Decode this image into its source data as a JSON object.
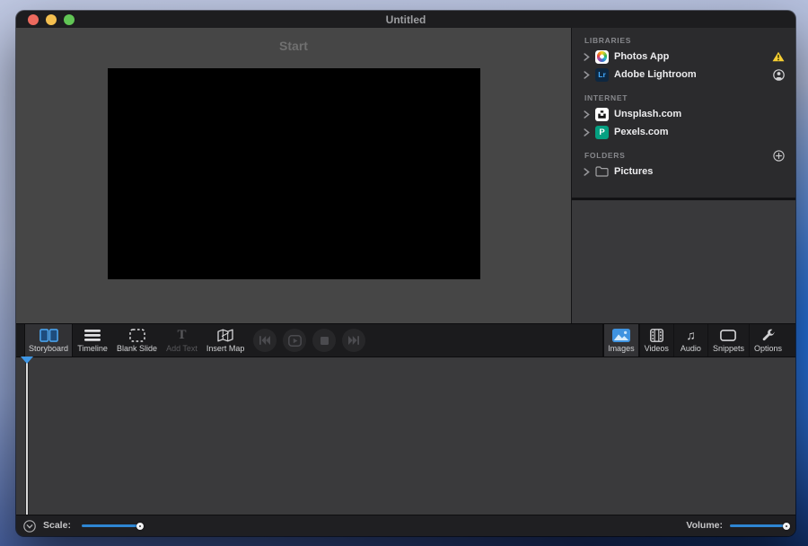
{
  "window": {
    "title": "Untitled"
  },
  "preview": {
    "start_label": "Start"
  },
  "sidebar": {
    "sections": [
      {
        "label": "LIBRARIES",
        "items": [
          {
            "label": "Photos App",
            "trailing_icon": "warning-icon"
          },
          {
            "label": "Adobe Lightroom",
            "trailing_icon": "account-icon"
          }
        ]
      },
      {
        "label": "INTERNET",
        "items": [
          {
            "label": "Unsplash.com"
          },
          {
            "label": "Pexels.com"
          }
        ]
      },
      {
        "label": "FOLDERS",
        "trailing_icon": "add-icon",
        "items": [
          {
            "label": "Pictures"
          }
        ]
      }
    ]
  },
  "icons": {
    "lightroom_glyph": "Lr",
    "pexels_glyph": "P",
    "add_text_glyph": "T",
    "audio_glyph": "♫"
  },
  "toolbar": {
    "left": [
      {
        "label": "Storyboard",
        "selected": true
      },
      {
        "label": "Timeline",
        "selected": false
      },
      {
        "label": "Blank Slide",
        "selected": false
      },
      {
        "label": "Add Text",
        "selected": false,
        "disabled": true
      },
      {
        "label": "Insert Map",
        "selected": false
      }
    ],
    "playback": [
      "skip-to-start",
      "play",
      "stop",
      "skip-to-end"
    ],
    "right": [
      {
        "label": "Images",
        "selected": true
      },
      {
        "label": "Videos",
        "selected": false
      },
      {
        "label": "Audio",
        "selected": false
      },
      {
        "label": "Snippets",
        "selected": false
      },
      {
        "label": "Options",
        "selected": false
      }
    ]
  },
  "bottom_bar": {
    "scale_label": "Scale:",
    "scale_slider_position": 1.0,
    "volume_label": "Volume:",
    "volume_slider_position": 1.0
  },
  "colors": {
    "accent_blue": "#3f93e0",
    "slider_blue": "#2e86d3",
    "warning_yellow": "#f6ce33",
    "pexels_green": "#05a081",
    "lightroom_navy": "#0e2740",
    "traffic_red": "#ed6a5e",
    "traffic_yellow": "#f4bf4f",
    "traffic_green": "#61c555",
    "storyboard_bg": "#3a3a3c",
    "preview_bg": "#464646"
  }
}
